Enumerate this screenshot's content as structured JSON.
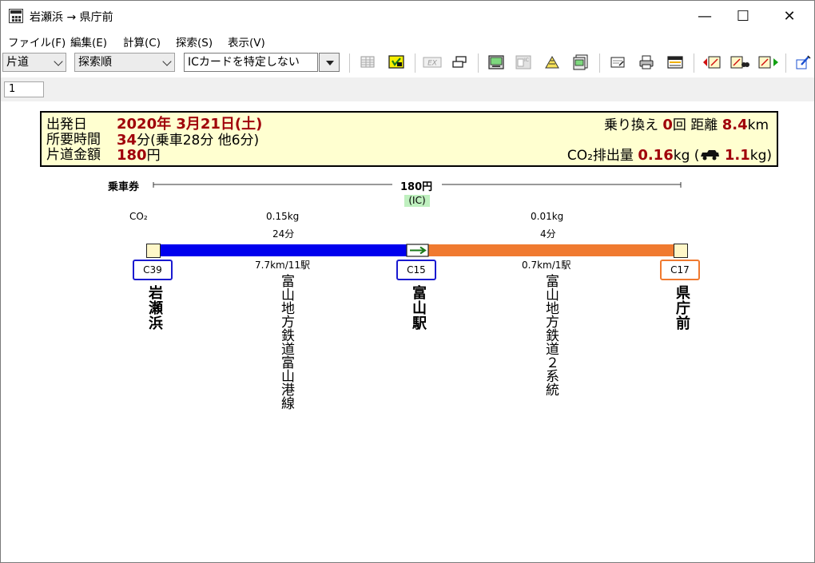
{
  "window": {
    "title": "岩瀬浜 → 県庁前",
    "controls": {
      "minimize": "—",
      "maximize": "☐",
      "close": "✕"
    }
  },
  "menu": [
    "ファイル(F)",
    "編集(E)",
    "計算(C)",
    "探索(S)",
    "表示(V)"
  ],
  "toolbar": {
    "trip_type": "片道",
    "sort_order": "探索順",
    "ic_card": "ICカードを特定しない",
    "icons": [
      "timetable-icon",
      "search-route-icon",
      "ex-icon",
      "print-route-icon",
      "ticket-card-icon",
      "ic-card-icon",
      "fare-calc-icon",
      "commuter-pass-icon",
      "memo-icon",
      "print-icon",
      "display-icon",
      "prev-route-icon",
      "detail-search-icon",
      "next-route-icon",
      "edit-settings-icon"
    ]
  },
  "tabs": [
    "1"
  ],
  "summary": {
    "departure_label": "出発日",
    "departure_value": "2020年 3月21日(土)",
    "duration_label": "所要時間",
    "duration_value": "34",
    "duration_unit": "分",
    "duration_detail": "(乗車28分 他6分)",
    "fare_label": "片道金額",
    "fare_value": "180",
    "fare_unit": "円",
    "transfers_label": "乗り換え",
    "transfers_value": "0",
    "transfers_unit": "回",
    "distance_label": "距離",
    "distance_value": "8.4",
    "distance_unit": "km",
    "co2_label": "CO₂排出量",
    "co2_value": "0.16",
    "co2_unit": "kg",
    "co2_car_paren_open": "(",
    "co2_car_value": "1.1",
    "co2_car_unit": "kg)"
  },
  "route": {
    "ticket_label": "乗車券",
    "ticket_fare": "180円",
    "ic_badge": "(IC)",
    "co2_header": "CO₂",
    "segments": [
      {
        "co2": "0.15kg",
        "time": "24分",
        "distance": "7.7km/11駅",
        "line": "富山地方鉄道富山港線",
        "color": "#0000ee"
      },
      {
        "co2": "0.01kg",
        "time": "4分",
        "distance": "0.7km/1駅",
        "line": "富山地方鉄道２系統",
        "color": "#f07a30"
      }
    ],
    "stations": [
      {
        "name": "岩瀬浜",
        "code": "C39",
        "code_color": "#1a1ad0"
      },
      {
        "name": "富山駅",
        "code": "C15",
        "code_color": "#1a1ad0"
      },
      {
        "name": "県庁前",
        "code": "C17",
        "code_color": "#f07a30"
      }
    ]
  },
  "colors": {
    "accent_red": "#a0000a",
    "info_bg": "#ffffd0"
  }
}
